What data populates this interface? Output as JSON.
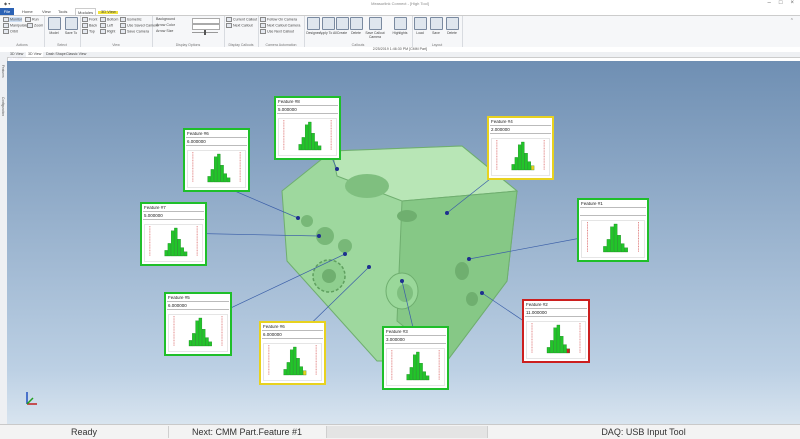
{
  "window": {
    "title": "Measurlink Connect - [High Tool]"
  },
  "ribbon_tabs": [
    "File",
    "Home",
    "View",
    "Tools",
    "Modules",
    "3D View"
  ],
  "ribbon": {
    "groups": [
      {
        "name": "Actions",
        "items": [
          "Monitor",
          "Run",
          "Manipulate",
          "Zoom",
          "Orbit"
        ]
      },
      {
        "name": "Select",
        "items": [
          "Model",
          "Save To"
        ]
      },
      {
        "name": "View",
        "items": [
          "Front",
          "Bottom",
          "Isometric",
          "Back",
          "Left",
          "Use Saved Camera",
          "Top",
          "Right",
          "Save Camera"
        ]
      },
      {
        "name": "Display Options",
        "items": [
          "Background",
          "Arrow Color",
          "Arrow Size"
        ]
      },
      {
        "name": "Display Callouts",
        "items": [
          "Current Callout",
          "Next Callout"
        ]
      },
      {
        "name": "Camera Automation",
        "items": [
          "Follow On Camera",
          "Next Callout Camera",
          "Use Next Callout"
        ]
      },
      {
        "name": "Callouts",
        "items": [
          "Designer",
          "Apply To All",
          "Create",
          "Delete",
          "Save Callout Camera",
          "Highlights"
        ]
      },
      {
        "name": "Layout",
        "items": [
          "Load",
          "Save",
          "Delete"
        ]
      }
    ]
  },
  "toolbar": {
    "info": "2/25/2019 1:46:30 PM [CMM Part]"
  },
  "view_tabs": [
    "3D View",
    "3D View",
    "Dash Shape",
    "Classic View"
  ],
  "viewport_label": "3D View",
  "left_panel": [
    "Features",
    "Configuration"
  ],
  "colors": {
    "green": "#1fbf2a",
    "yellow": "#e8d21f",
    "red": "#cc1f1f",
    "link": "#3b5fa8",
    "model": "#9ed89e"
  },
  "callouts": [
    {
      "name": "Feature #8",
      "value": "5.000000",
      "status": "green"
    },
    {
      "name": "Feature #6",
      "value": "6.000000",
      "status": "green"
    },
    {
      "name": "Feature #4",
      "value": "2.000000",
      "status": "yellow"
    },
    {
      "name": "Feature #7",
      "value": "5.000000",
      "status": "green"
    },
    {
      "name": "Feature #1",
      "value": "",
      "status": "green"
    },
    {
      "name": "Feature #5",
      "value": "6.000000",
      "status": "green"
    },
    {
      "name": "Feature #6",
      "value": "6.000000",
      "status": "yellow"
    },
    {
      "name": "Feature #3",
      "value": "3.000000",
      "status": "green"
    },
    {
      "name": "Feature #2",
      "value": "11.000000",
      "status": "red"
    }
  ],
  "status": {
    "left": "Ready",
    "next": "Next: CMM Part.Feature #1",
    "daq": "DAQ: USB Input Tool"
  }
}
